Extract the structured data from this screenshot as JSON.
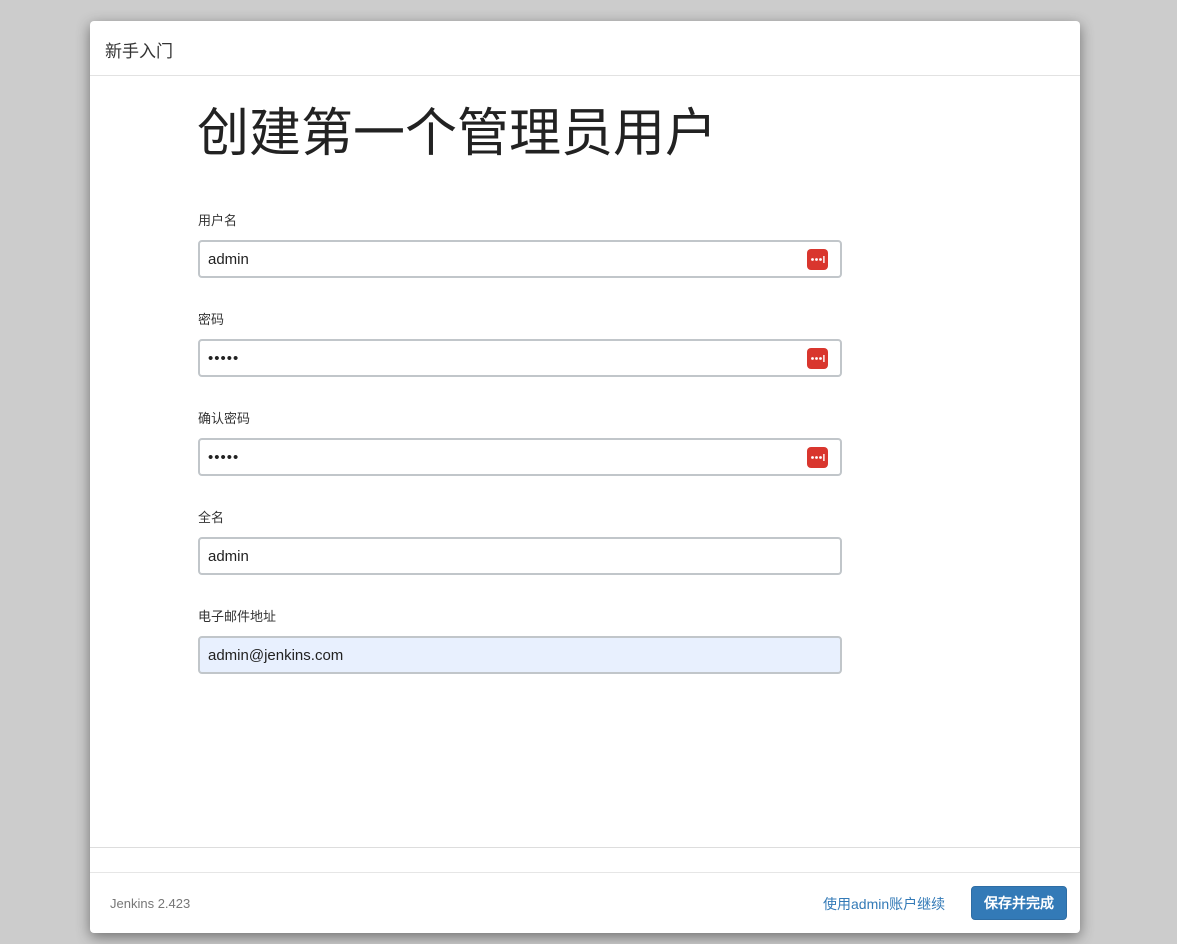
{
  "header": {
    "title": "新手入门"
  },
  "main": {
    "heading": "创建第一个管理员用户",
    "fields": {
      "username": {
        "label": "用户名",
        "value": "admin"
      },
      "password": {
        "label": "密码",
        "value": "admin"
      },
      "confirm_password": {
        "label": "确认密码",
        "value": "admin"
      },
      "fullname": {
        "label": "全名",
        "value": "admin"
      },
      "email": {
        "label": "电子邮件地址",
        "value": "admin@jenkins.com"
      }
    }
  },
  "footer": {
    "version": "Jenkins 2.423",
    "continue_link": "使用admin账户继续",
    "save_button": "保存并完成"
  },
  "colors": {
    "primary": "#337ab7",
    "password_manager_icon": "#d9362e",
    "autofill_background": "#e8f0fe",
    "backdrop": "#cccccc"
  }
}
